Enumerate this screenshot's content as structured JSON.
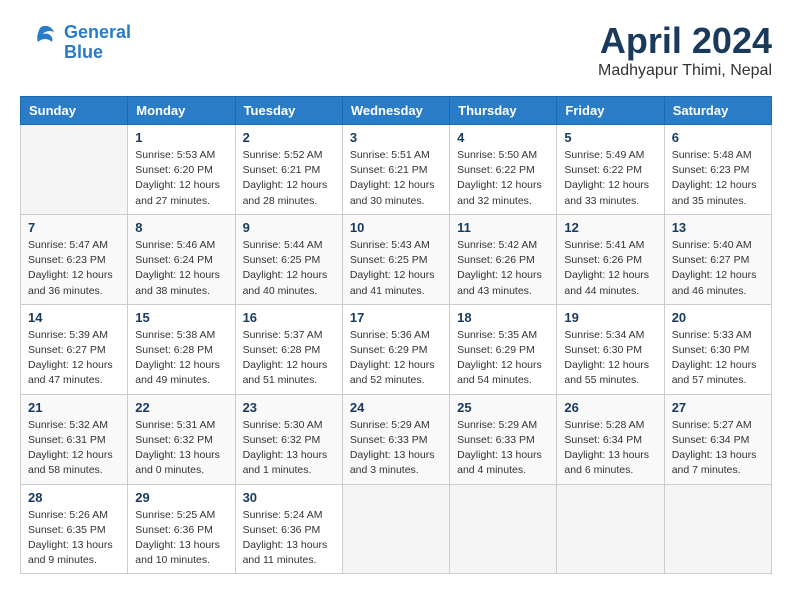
{
  "header": {
    "logo_line1": "General",
    "logo_line2": "Blue",
    "month": "April 2024",
    "location": "Madhyapur Thimi, Nepal"
  },
  "weekdays": [
    "Sunday",
    "Monday",
    "Tuesday",
    "Wednesday",
    "Thursday",
    "Friday",
    "Saturday"
  ],
  "weeks": [
    [
      {
        "day": "",
        "info": ""
      },
      {
        "day": "1",
        "info": "Sunrise: 5:53 AM\nSunset: 6:20 PM\nDaylight: 12 hours\nand 27 minutes."
      },
      {
        "day": "2",
        "info": "Sunrise: 5:52 AM\nSunset: 6:21 PM\nDaylight: 12 hours\nand 28 minutes."
      },
      {
        "day": "3",
        "info": "Sunrise: 5:51 AM\nSunset: 6:21 PM\nDaylight: 12 hours\nand 30 minutes."
      },
      {
        "day": "4",
        "info": "Sunrise: 5:50 AM\nSunset: 6:22 PM\nDaylight: 12 hours\nand 32 minutes."
      },
      {
        "day": "5",
        "info": "Sunrise: 5:49 AM\nSunset: 6:22 PM\nDaylight: 12 hours\nand 33 minutes."
      },
      {
        "day": "6",
        "info": "Sunrise: 5:48 AM\nSunset: 6:23 PM\nDaylight: 12 hours\nand 35 minutes."
      }
    ],
    [
      {
        "day": "7",
        "info": "Sunrise: 5:47 AM\nSunset: 6:23 PM\nDaylight: 12 hours\nand 36 minutes."
      },
      {
        "day": "8",
        "info": "Sunrise: 5:46 AM\nSunset: 6:24 PM\nDaylight: 12 hours\nand 38 minutes."
      },
      {
        "day": "9",
        "info": "Sunrise: 5:44 AM\nSunset: 6:25 PM\nDaylight: 12 hours\nand 40 minutes."
      },
      {
        "day": "10",
        "info": "Sunrise: 5:43 AM\nSunset: 6:25 PM\nDaylight: 12 hours\nand 41 minutes."
      },
      {
        "day": "11",
        "info": "Sunrise: 5:42 AM\nSunset: 6:26 PM\nDaylight: 12 hours\nand 43 minutes."
      },
      {
        "day": "12",
        "info": "Sunrise: 5:41 AM\nSunset: 6:26 PM\nDaylight: 12 hours\nand 44 minutes."
      },
      {
        "day": "13",
        "info": "Sunrise: 5:40 AM\nSunset: 6:27 PM\nDaylight: 12 hours\nand 46 minutes."
      }
    ],
    [
      {
        "day": "14",
        "info": "Sunrise: 5:39 AM\nSunset: 6:27 PM\nDaylight: 12 hours\nand 47 minutes."
      },
      {
        "day": "15",
        "info": "Sunrise: 5:38 AM\nSunset: 6:28 PM\nDaylight: 12 hours\nand 49 minutes."
      },
      {
        "day": "16",
        "info": "Sunrise: 5:37 AM\nSunset: 6:28 PM\nDaylight: 12 hours\nand 51 minutes."
      },
      {
        "day": "17",
        "info": "Sunrise: 5:36 AM\nSunset: 6:29 PM\nDaylight: 12 hours\nand 52 minutes."
      },
      {
        "day": "18",
        "info": "Sunrise: 5:35 AM\nSunset: 6:29 PM\nDaylight: 12 hours\nand 54 minutes."
      },
      {
        "day": "19",
        "info": "Sunrise: 5:34 AM\nSunset: 6:30 PM\nDaylight: 12 hours\nand 55 minutes."
      },
      {
        "day": "20",
        "info": "Sunrise: 5:33 AM\nSunset: 6:30 PM\nDaylight: 12 hours\nand 57 minutes."
      }
    ],
    [
      {
        "day": "21",
        "info": "Sunrise: 5:32 AM\nSunset: 6:31 PM\nDaylight: 12 hours\nand 58 minutes."
      },
      {
        "day": "22",
        "info": "Sunrise: 5:31 AM\nSunset: 6:32 PM\nDaylight: 13 hours\nand 0 minutes."
      },
      {
        "day": "23",
        "info": "Sunrise: 5:30 AM\nSunset: 6:32 PM\nDaylight: 13 hours\nand 1 minutes."
      },
      {
        "day": "24",
        "info": "Sunrise: 5:29 AM\nSunset: 6:33 PM\nDaylight: 13 hours\nand 3 minutes."
      },
      {
        "day": "25",
        "info": "Sunrise: 5:29 AM\nSunset: 6:33 PM\nDaylight: 13 hours\nand 4 minutes."
      },
      {
        "day": "26",
        "info": "Sunrise: 5:28 AM\nSunset: 6:34 PM\nDaylight: 13 hours\nand 6 minutes."
      },
      {
        "day": "27",
        "info": "Sunrise: 5:27 AM\nSunset: 6:34 PM\nDaylight: 13 hours\nand 7 minutes."
      }
    ],
    [
      {
        "day": "28",
        "info": "Sunrise: 5:26 AM\nSunset: 6:35 PM\nDaylight: 13 hours\nand 9 minutes."
      },
      {
        "day": "29",
        "info": "Sunrise: 5:25 AM\nSunset: 6:36 PM\nDaylight: 13 hours\nand 10 minutes."
      },
      {
        "day": "30",
        "info": "Sunrise: 5:24 AM\nSunset: 6:36 PM\nDaylight: 13 hours\nand 11 minutes."
      },
      {
        "day": "",
        "info": ""
      },
      {
        "day": "",
        "info": ""
      },
      {
        "day": "",
        "info": ""
      },
      {
        "day": "",
        "info": ""
      }
    ]
  ]
}
